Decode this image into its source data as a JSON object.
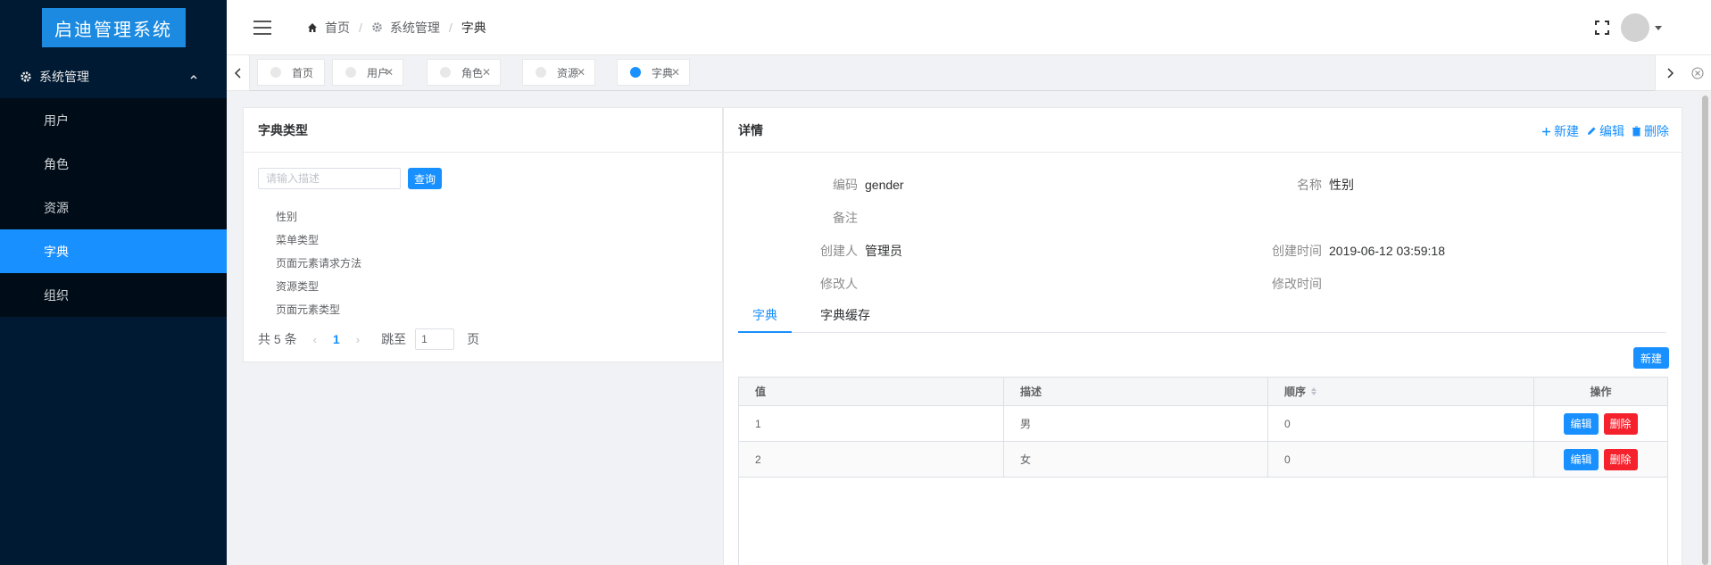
{
  "app": {
    "logo_text": "启迪管理系统"
  },
  "sidebar": {
    "group": {
      "label": "系统管理",
      "icon": "gear-icon",
      "expanded": true
    },
    "items": [
      {
        "label": "用户",
        "active": false
      },
      {
        "label": "角色",
        "active": false
      },
      {
        "label": "资源",
        "active": false
      },
      {
        "label": "字典",
        "active": true
      },
      {
        "label": "组织",
        "active": false
      }
    ]
  },
  "header": {
    "breadcrumb": [
      {
        "label": "首页",
        "icon": "home-icon"
      },
      {
        "label": "系统管理",
        "icon": "gear-icon"
      },
      {
        "label": "字典"
      }
    ]
  },
  "tabs": [
    {
      "label": "首页",
      "closable": false,
      "active": false
    },
    {
      "label": "用户",
      "closable": true,
      "active": false
    },
    {
      "label": "角色",
      "closable": true,
      "active": false
    },
    {
      "label": "资源",
      "closable": true,
      "active": false
    },
    {
      "label": "字典",
      "closable": true,
      "active": true
    }
  ],
  "left_panel": {
    "title": "字典类型",
    "search_placeholder": "请输入描述",
    "search_value": "",
    "search_button": "查询",
    "types": [
      "性别",
      "菜单类型",
      "页面元素请求方法",
      "资源类型",
      "页面元素类型"
    ],
    "pager": {
      "total_text": "共 5 条",
      "current_page": "1",
      "goto_label": "跳至",
      "goto_value": "1",
      "page_suffix": "页"
    }
  },
  "detail": {
    "title": "详情",
    "actions": {
      "new": "新建",
      "edit": "编辑",
      "delete": "删除"
    },
    "fields": {
      "code_label": "编码",
      "code_value": "gender",
      "name_label": "名称",
      "name_value": "性别",
      "remark_label": "备注",
      "remark_value": "",
      "creator_label": "创建人",
      "creator_value": "管理员",
      "created_label": "创建时间",
      "created_value": "2019-06-12 03:59:18",
      "modifier_label": "修改人",
      "modifier_value": "",
      "modified_label": "修改时间",
      "modified_value": ""
    },
    "inner_tabs": [
      {
        "label": "字典",
        "active": true
      },
      {
        "label": "字典缓存",
        "active": false
      }
    ],
    "new_button": "新建",
    "table": {
      "columns": [
        "值",
        "描述",
        "顺序",
        "操作"
      ],
      "rows": [
        {
          "value": "1",
          "desc": "男",
          "order": "0"
        },
        {
          "value": "2",
          "desc": "女",
          "order": "0"
        }
      ],
      "edit_label": "编辑",
      "delete_label": "删除"
    }
  },
  "colors": {
    "primary": "#1890ff",
    "danger": "#f5222d",
    "sidebar_bg": "#001a33",
    "logo_bg": "#1b8ae0"
  }
}
